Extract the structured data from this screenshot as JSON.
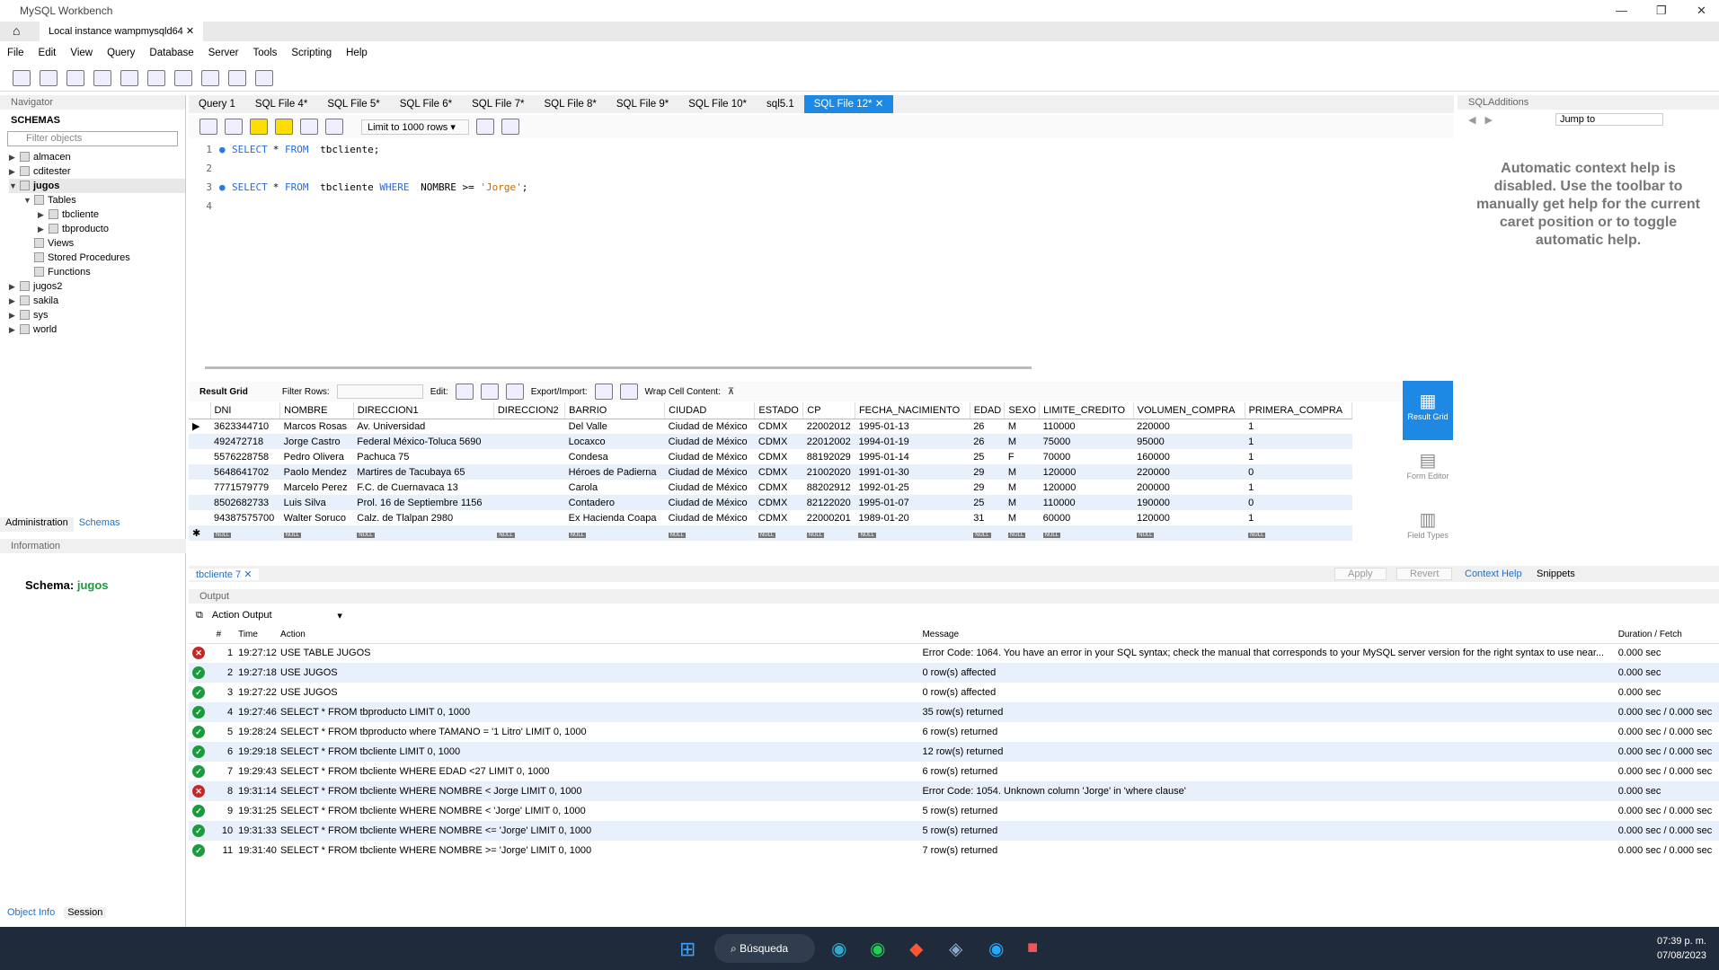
{
  "window": {
    "title": "MySQL Workbench",
    "connection_tab": "Local instance wampmysqld64"
  },
  "menu": [
    "File",
    "Edit",
    "View",
    "Query",
    "Database",
    "Server",
    "Tools",
    "Scripting",
    "Help"
  ],
  "navigator": {
    "header": "Navigator",
    "schemas_label": "SCHEMAS",
    "filter_placeholder": "Filter objects",
    "tree": [
      {
        "name": "almacen"
      },
      {
        "name": "cditester"
      },
      {
        "name": "jugos",
        "expanded": true,
        "children": [
          "Tables",
          "tbcliente",
          "tbproducto",
          "Views",
          "Stored Procedures",
          "Functions"
        ]
      },
      {
        "name": "jugos2"
      },
      {
        "name": "sakila"
      },
      {
        "name": "sys"
      },
      {
        "name": "world"
      }
    ],
    "tabs": [
      "Administration",
      "Schemas"
    ],
    "info_header": "Information",
    "schema_label": "Schema:",
    "schema_value": "jugos",
    "bottom_tabs": [
      "Object Info",
      "Session"
    ]
  },
  "editor": {
    "tabs": [
      "Query 1",
      "SQL File 4*",
      "SQL File 5*",
      "SQL File 6*",
      "SQL File 7*",
      "SQL File 8*",
      "SQL File 9*",
      "SQL File 10*",
      "sql5.1",
      "SQL File 12*"
    ],
    "active_tab": "SQL File 12*",
    "limit": "Limit to 1000 rows",
    "lines": [
      {
        "n": "1",
        "parts": [
          [
            "kw",
            "SELECT"
          ],
          [
            "",
            "* "
          ],
          [
            "kw",
            "FROM"
          ],
          [
            "",
            " tbcliente;"
          ]
        ]
      },
      {
        "n": "2",
        "parts": []
      },
      {
        "n": "3",
        "parts": [
          [
            "kw",
            "SELECT"
          ],
          [
            "",
            "* "
          ],
          [
            "kw",
            "FROM"
          ],
          [
            "",
            " tbcliente "
          ],
          [
            "kw",
            "WHERE"
          ],
          [
            "",
            " NOMBRE >= "
          ],
          [
            "str",
            "'Jorge'"
          ],
          [
            "",
            ";"
          ]
        ]
      },
      {
        "n": "4",
        "parts": []
      }
    ]
  },
  "sql_additions": {
    "header": "SQLAdditions",
    "jump_to": "Jump to",
    "help": "Automatic context help is disabled. Use the toolbar to manually get help for the current caret position or to toggle automatic help.",
    "tabs": [
      "Context Help",
      "Snippets"
    ]
  },
  "result": {
    "toolbar": {
      "result_grid": "Result Grid",
      "filter_rows": "Filter Rows:",
      "edit": "Edit:",
      "export_import": "Export/Import:",
      "wrap": "Wrap Cell Content:"
    },
    "columns": [
      "DNI",
      "NOMBRE",
      "DIRECCION1",
      "DIRECCION2",
      "BARRIO",
      "CIUDAD",
      "ESTADO",
      "CP",
      "FECHA_NACIMIENTO",
      "EDAD",
      "SEXO",
      "LIMITE_CREDITO",
      "VOLUMEN_COMPRA",
      "PRIMERA_COMPRA"
    ],
    "rows": [
      [
        "3623344710",
        "Marcos Rosas",
        "Av. Universidad",
        "",
        "Del Valle",
        "Ciudad de México",
        "CDMX",
        "22002012",
        "1995-01-13",
        "26",
        "M",
        "110000",
        "220000",
        "1"
      ],
      [
        "492472718",
        "Jorge Castro",
        "Federal México-Toluca 5690",
        "",
        "Locaxco",
        "Ciudad de México",
        "CDMX",
        "22012002",
        "1994-01-19",
        "26",
        "M",
        "75000",
        "95000",
        "1"
      ],
      [
        "5576228758",
        "Pedro Olivera",
        "Pachuca 75",
        "",
        "Condesa",
        "Ciudad de México",
        "CDMX",
        "88192029",
        "1995-01-14",
        "25",
        "F",
        "70000",
        "160000",
        "1"
      ],
      [
        "5648641702",
        "Paolo Mendez",
        "Martires de Tacubaya 65",
        "",
        "Héroes de Padierna",
        "Ciudad de México",
        "CDMX",
        "21002020",
        "1991-01-30",
        "29",
        "M",
        "120000",
        "220000",
        "0"
      ],
      [
        "7771579779",
        "Marcelo Perez",
        "F.C. de Cuernavaca 13",
        "",
        "Carola",
        "Ciudad de México",
        "CDMX",
        "88202912",
        "1992-01-25",
        "29",
        "M",
        "120000",
        "200000",
        "1"
      ],
      [
        "8502682733",
        "Luis Silva",
        "Prol. 16 de Septiembre 1156",
        "",
        "Contadero",
        "Ciudad de México",
        "CDMX",
        "82122020",
        "1995-01-07",
        "25",
        "M",
        "110000",
        "190000",
        "0"
      ],
      [
        "94387575700",
        "Walter Soruco",
        "Calz. de Tlalpan 2980",
        "",
        "Ex Hacienda Coapa",
        "Ciudad de México",
        "CDMX",
        "22000201",
        "1989-01-20",
        "31",
        "M",
        "60000",
        "120000",
        "1"
      ]
    ],
    "null_label": "NULL",
    "side_buttons": [
      "Result Grid",
      "Form Editor",
      "Field Types"
    ],
    "tab": "tbcliente 7",
    "apply": "Apply",
    "revert": "Revert"
  },
  "output": {
    "header": "Output",
    "selector": "Action Output",
    "columns": [
      "#",
      "Time",
      "Action",
      "Message",
      "Duration / Fetch"
    ],
    "rows": [
      [
        "error",
        "1",
        "19:27:12",
        "USE TABLE JUGOS",
        "Error Code: 1064. You have an error in your SQL syntax; check the manual that corresponds to your MySQL server version for the right syntax to use near...",
        "0.000 sec"
      ],
      [
        "ok",
        "2",
        "19:27:18",
        "USE JUGOS",
        "0 row(s) affected",
        "0.000 sec"
      ],
      [
        "ok",
        "3",
        "19:27:22",
        "USE JUGOS",
        "0 row(s) affected",
        "0.000 sec"
      ],
      [
        "ok",
        "4",
        "19:27:46",
        "SELECT * FROM tbproducto LIMIT 0, 1000",
        "35 row(s) returned",
        "0.000 sec / 0.000 sec"
      ],
      [
        "ok",
        "5",
        "19:28:24",
        "SELECT * FROM tbproducto where TAMANO = '1 Litro' LIMIT 0, 1000",
        "6 row(s) returned",
        "0.000 sec / 0.000 sec"
      ],
      [
        "ok",
        "6",
        "19:29:18",
        "SELECT * FROM tbcliente LIMIT 0, 1000",
        "12 row(s) returned",
        "0.000 sec / 0.000 sec"
      ],
      [
        "ok",
        "7",
        "19:29:43",
        "SELECT * FROM tbcliente WHERE EDAD <27 LIMIT 0, 1000",
        "6 row(s) returned",
        "0.000 sec / 0.000 sec"
      ],
      [
        "error",
        "8",
        "19:31:14",
        "SELECT * FROM tbcliente WHERE NOMBRE < Jorge LIMIT 0, 1000",
        "Error Code: 1054. Unknown column 'Jorge' in 'where clause'",
        "0.000 sec"
      ],
      [
        "ok",
        "9",
        "19:31:25",
        "SELECT * FROM tbcliente WHERE NOMBRE < 'Jorge' LIMIT 0, 1000",
        "5 row(s) returned",
        "0.000 sec / 0.000 sec"
      ],
      [
        "ok",
        "10",
        "19:31:33",
        "SELECT * FROM tbcliente WHERE NOMBRE <= 'Jorge' LIMIT 0, 1000",
        "5 row(s) returned",
        "0.000 sec / 0.000 sec"
      ],
      [
        "ok",
        "11",
        "19:31:40",
        "SELECT * FROM tbcliente WHERE NOMBRE >= 'Jorge' LIMIT 0, 1000",
        "7 row(s) returned",
        "0.000 sec / 0.000 sec"
      ]
    ]
  },
  "taskbar": {
    "search": "Búsqueda",
    "time": "07:39 p. m.",
    "date": "07/08/2023"
  },
  "colors": {
    "accent": "#1e88e5",
    "ok": "#1a9b3c",
    "error": "#c62828"
  }
}
